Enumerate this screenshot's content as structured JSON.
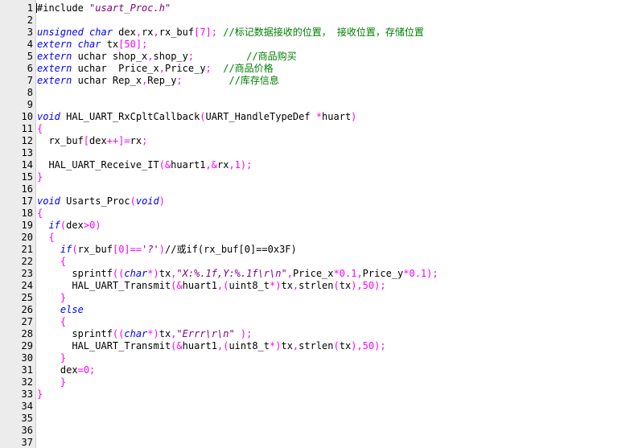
{
  "editor": {
    "colors": {
      "default": "#000000",
      "keyword": "#0000ff",
      "type": "#ff00ff",
      "string": "#800080",
      "number": "#ff00ff",
      "punct": "#ff00ff",
      "comment": "#008000",
      "gutter_bg": "#ececec"
    },
    "lines": [
      {
        "n": "1",
        "tokens": [
          [
            "#include ",
            "default"
          ],
          [
            "\"usart_Proc.h\"",
            "string"
          ]
        ]
      },
      {
        "n": "2",
        "tokens": []
      },
      {
        "n": "3",
        "tokens": [
          [
            "unsigned char",
            "keyword"
          ],
          [
            " dex",
            "default"
          ],
          [
            ",",
            "punct"
          ],
          [
            "rx",
            "default"
          ],
          [
            ",",
            "punct"
          ],
          [
            "rx_buf",
            "default"
          ],
          [
            "[7];",
            "punct"
          ],
          [
            " ",
            "default"
          ],
          [
            "//标记数据接收的位置， 接收位置，存储位置",
            "comment"
          ]
        ]
      },
      {
        "n": "4",
        "tokens": [
          [
            "extern char",
            "keyword"
          ],
          [
            " tx",
            "default"
          ],
          [
            "[50];",
            "punct"
          ]
        ]
      },
      {
        "n": "5",
        "tokens": [
          [
            "extern",
            "keyword"
          ],
          [
            " uchar shop_x",
            "default"
          ],
          [
            ",",
            "punct"
          ],
          [
            "shop_y",
            "default"
          ],
          [
            ";",
            "punct"
          ],
          [
            "         ",
            "default"
          ],
          [
            "//商品购买",
            "comment"
          ]
        ]
      },
      {
        "n": "6",
        "tokens": [
          [
            "extern",
            "keyword"
          ],
          [
            " uchar  Price_x",
            "default"
          ],
          [
            ",",
            "punct"
          ],
          [
            "Price_y",
            "default"
          ],
          [
            ";",
            "punct"
          ],
          [
            "  ",
            "default"
          ],
          [
            "//商品价格",
            "comment"
          ]
        ]
      },
      {
        "n": "7",
        "tokens": [
          [
            "extern",
            "keyword"
          ],
          [
            " uchar Rep_x",
            "default"
          ],
          [
            ",",
            "punct"
          ],
          [
            "Rep_y",
            "default"
          ],
          [
            ";",
            "punct"
          ],
          [
            "        ",
            "default"
          ],
          [
            "//库存信息",
            "comment"
          ]
        ]
      },
      {
        "n": "8",
        "tokens": []
      },
      {
        "n": "9",
        "tokens": []
      },
      {
        "n": "10",
        "tokens": [
          [
            "void",
            "keyword"
          ],
          [
            " HAL_UART_RxCpltCallback",
            "default"
          ],
          [
            "(",
            "punct"
          ],
          [
            "UART_HandleTypeDef ",
            "default"
          ],
          [
            "*",
            "punct"
          ],
          [
            "huart",
            "default"
          ],
          [
            ")",
            "punct"
          ]
        ]
      },
      {
        "n": "11",
        "tokens": [
          [
            "{",
            "punct"
          ]
        ]
      },
      {
        "n": "12",
        "tokens": [
          [
            "  rx_buf",
            "default"
          ],
          [
            "[",
            "punct"
          ],
          [
            "dex",
            "default"
          ],
          [
            "++]=",
            "punct"
          ],
          [
            "rx",
            "default"
          ],
          [
            ";",
            "punct"
          ]
        ]
      },
      {
        "n": "13",
        "tokens": []
      },
      {
        "n": "14",
        "tokens": [
          [
            "  HAL_UART_Receive_IT",
            "default"
          ],
          [
            "(&",
            "punct"
          ],
          [
            "huart1",
            "default"
          ],
          [
            ",&",
            "punct"
          ],
          [
            "rx",
            "default"
          ],
          [
            ",",
            "punct"
          ],
          [
            "1",
            "number"
          ],
          [
            ");",
            "punct"
          ]
        ]
      },
      {
        "n": "15",
        "tokens": [
          [
            "}",
            "punct"
          ]
        ]
      },
      {
        "n": "16",
        "tokens": []
      },
      {
        "n": "17",
        "tokens": [
          [
            "void",
            "keyword"
          ],
          [
            " Usarts_Proc",
            "default"
          ],
          [
            "(",
            "punct"
          ],
          [
            "void",
            "keyword"
          ],
          [
            ")",
            "punct"
          ]
        ]
      },
      {
        "n": "18",
        "tokens": [
          [
            "{",
            "punct"
          ]
        ]
      },
      {
        "n": "19",
        "tokens": [
          [
            "  ",
            "default"
          ],
          [
            "if",
            "keyword"
          ],
          [
            "(",
            "punct"
          ],
          [
            "dex",
            "default"
          ],
          [
            ">",
            "punct"
          ],
          [
            "0",
            "number"
          ],
          [
            ")",
            "punct"
          ]
        ]
      },
      {
        "n": "20",
        "tokens": [
          [
            "  {",
            "punct"
          ]
        ]
      },
      {
        "n": "21",
        "tokens": [
          [
            "    ",
            "default"
          ],
          [
            "if",
            "keyword"
          ],
          [
            "(",
            "punct"
          ],
          [
            "rx_buf",
            "default"
          ],
          [
            "[",
            "punct"
          ],
          [
            "0",
            "number"
          ],
          [
            "]==",
            "punct"
          ],
          [
            "'?'",
            "string"
          ],
          [
            ")",
            "punct"
          ],
          [
            "//或if(rx_buf[0]==0x3F)",
            "default"
          ]
        ]
      },
      {
        "n": "22",
        "tokens": [
          [
            "    {",
            "punct"
          ]
        ]
      },
      {
        "n": "23",
        "tokens": [
          [
            "      sprintf",
            "default"
          ],
          [
            "((",
            "punct"
          ],
          [
            "char",
            "keyword"
          ],
          [
            "*)",
            "punct"
          ],
          [
            "tx",
            "default"
          ],
          [
            ",",
            "punct"
          ],
          [
            "\"X:%.1f,Y:%.1f\\r\\n\"",
            "string"
          ],
          [
            ",",
            "punct"
          ],
          [
            "Price_x",
            "default"
          ],
          [
            "*",
            "punct"
          ],
          [
            "0.1",
            "number"
          ],
          [
            ",",
            "punct"
          ],
          [
            "Price_y",
            "default"
          ],
          [
            "*",
            "punct"
          ],
          [
            "0.1",
            "number"
          ],
          [
            ");",
            "punct"
          ]
        ]
      },
      {
        "n": "24",
        "tokens": [
          [
            "      HAL_UART_Transmit",
            "default"
          ],
          [
            "(&",
            "punct"
          ],
          [
            "huart1",
            "default"
          ],
          [
            ",(",
            "punct"
          ],
          [
            "uint8_t",
            "default"
          ],
          [
            "*)",
            "punct"
          ],
          [
            "tx",
            "default"
          ],
          [
            ",",
            "punct"
          ],
          [
            "strlen",
            "default"
          ],
          [
            "(",
            "punct"
          ],
          [
            "tx",
            "default"
          ],
          [
            "),",
            "punct"
          ],
          [
            "50",
            "number"
          ],
          [
            ");",
            "punct"
          ]
        ]
      },
      {
        "n": "25",
        "tokens": [
          [
            "    }",
            "punct"
          ]
        ]
      },
      {
        "n": "26",
        "tokens": [
          [
            "    ",
            "default"
          ],
          [
            "else",
            "keyword"
          ]
        ]
      },
      {
        "n": "27",
        "tokens": [
          [
            "    {",
            "punct"
          ]
        ]
      },
      {
        "n": "28",
        "tokens": [
          [
            "      sprintf",
            "default"
          ],
          [
            "((",
            "punct"
          ],
          [
            "char",
            "keyword"
          ],
          [
            "*)",
            "punct"
          ],
          [
            "tx",
            "default"
          ],
          [
            ",",
            "punct"
          ],
          [
            "\"Errr\\r\\n\"",
            "string"
          ],
          [
            " );",
            "punct"
          ]
        ]
      },
      {
        "n": "29",
        "tokens": [
          [
            "      HAL_UART_Transmit",
            "default"
          ],
          [
            "(&",
            "punct"
          ],
          [
            "huart1",
            "default"
          ],
          [
            ",(",
            "punct"
          ],
          [
            "uint8_t",
            "default"
          ],
          [
            "*)",
            "punct"
          ],
          [
            "tx",
            "default"
          ],
          [
            ",",
            "punct"
          ],
          [
            "strlen",
            "default"
          ],
          [
            "(",
            "punct"
          ],
          [
            "tx",
            "default"
          ],
          [
            "),",
            "punct"
          ],
          [
            "50",
            "number"
          ],
          [
            ");",
            "punct"
          ]
        ]
      },
      {
        "n": "30",
        "tokens": [
          [
            "    }",
            "punct"
          ]
        ]
      },
      {
        "n": "31",
        "tokens": [
          [
            "    dex",
            "default"
          ],
          [
            "=",
            "punct"
          ],
          [
            "0",
            "number"
          ],
          [
            ";",
            "punct"
          ]
        ]
      },
      {
        "n": "32",
        "tokens": [
          [
            "    }",
            "punct"
          ]
        ]
      },
      {
        "n": "33",
        "tokens": [
          [
            "}",
            "punct"
          ]
        ]
      },
      {
        "n": "34",
        "tokens": []
      },
      {
        "n": "35",
        "tokens": []
      },
      {
        "n": "36",
        "tokens": []
      },
      {
        "n": "37",
        "tokens": []
      }
    ]
  }
}
